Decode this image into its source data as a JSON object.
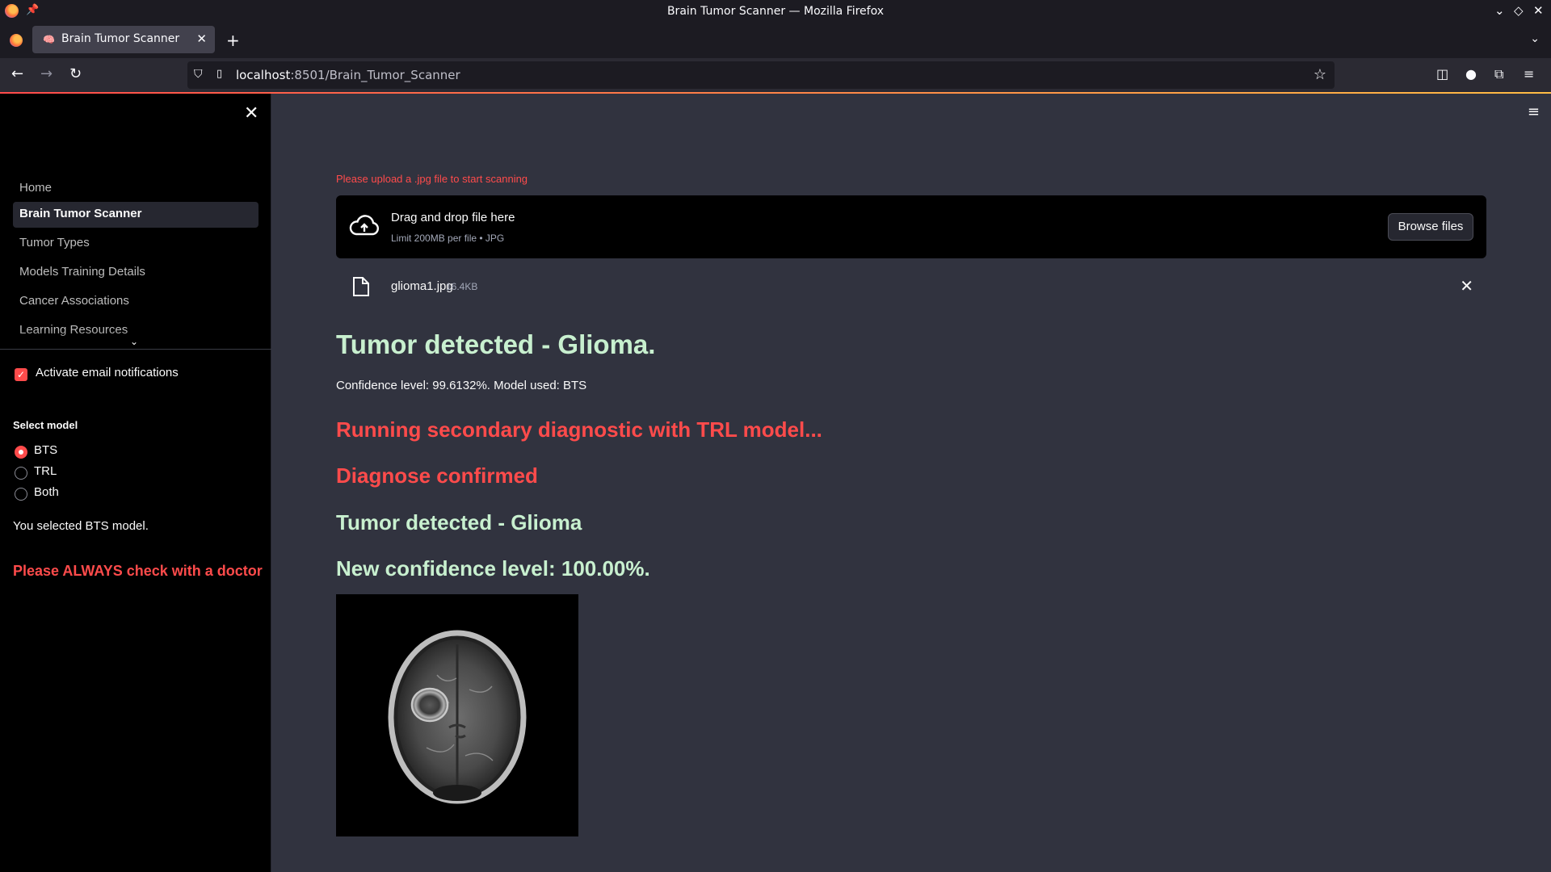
{
  "browser": {
    "window_title": "Brain Tumor Scanner — Mozilla Firefox",
    "tab_title": "Brain Tumor Scanner",
    "tab_favicon": "brain-emoji",
    "url_host": "localhost",
    "url_path": ":8501/Brain_Tumor_Scanner"
  },
  "sidebar": {
    "nav_items": [
      {
        "label": "Home",
        "active": false
      },
      {
        "label": "Brain Tumor Scanner",
        "active": true
      },
      {
        "label": "Tumor Types",
        "active": false
      },
      {
        "label": "Models Training Details",
        "active": false
      },
      {
        "label": "Cancer Associations",
        "active": false
      },
      {
        "label": "Learning Resources",
        "active": false
      }
    ],
    "email_checkbox": {
      "label": "Activate email notifications",
      "checked": true
    },
    "model_select": {
      "label": "Select model",
      "options": [
        "BTS",
        "TRL",
        "Both"
      ],
      "selected": "BTS"
    },
    "selected_info": "You selected BTS model.",
    "warning": "Please ALWAYS check with a doctor"
  },
  "main": {
    "upload_label": "Please upload a .jpg file to start scanning",
    "dropzone": {
      "title": "Drag and drop file here",
      "limit": "Limit 200MB per file • JPG",
      "browse_label": "Browse files"
    },
    "file": {
      "name": "glioma1.jpg",
      "size": "16.4KB"
    },
    "result_heading": "Tumor detected - Glioma.",
    "confidence_text": "Confidence level: 99.6132%. Model used: BTS",
    "secondary_heading": "Running secondary diagnostic with TRL model...",
    "confirmed_heading": "Diagnose confirmed",
    "secondary_result": "Tumor detected - Glioma",
    "new_confidence": "New confidence level: 100.00%."
  },
  "colors": {
    "accent_red": "#ff4b4b",
    "success_green": "#c8f0cf",
    "main_bg": "#31333f",
    "sidebar_bg": "#000000"
  }
}
